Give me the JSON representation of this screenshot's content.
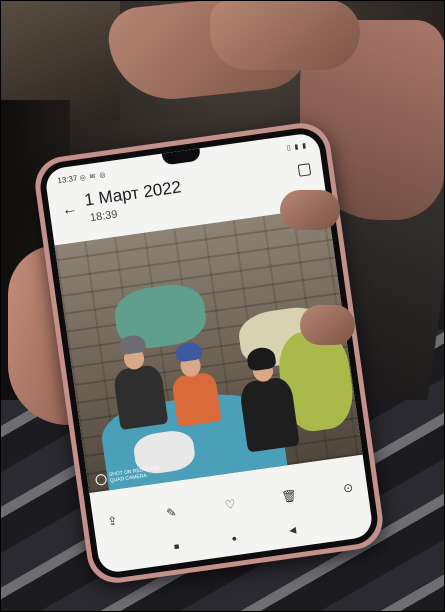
{
  "status_bar": {
    "time": "13:37",
    "left_icons": "◎ ✉ ◎",
    "right_icons": "▯ ▮ ▮"
  },
  "header": {
    "date": "1 Март 2022",
    "time": "18:39"
  },
  "icons": {
    "back": "←",
    "share": "⇪",
    "edit": "✎",
    "favorite": "♡",
    "delete": "🗑",
    "more": "⊙",
    "nav_recent": "■",
    "nav_home": "●",
    "nav_back": "◀"
  },
  "watermark": {
    "text": "SHOT ON REDMI 9 AI QUAD CAMERA"
  },
  "colors": {
    "phone_case": "#c4908a",
    "screen_bg": "#f4f4f2",
    "blanket_blue": "#4aa0b8",
    "blanket_green": "#a9b94a"
  }
}
